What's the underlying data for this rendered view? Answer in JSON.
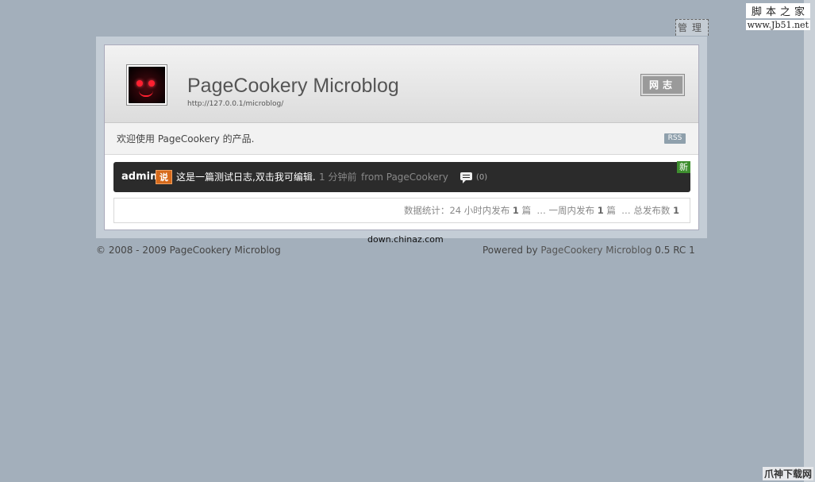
{
  "watermarks": {
    "top_line1": "脚本之家",
    "top_line2": "www.Jb51.net",
    "center": "down.chinaz.com",
    "bottom": "爪神下载网"
  },
  "admin_link": "管理",
  "header": {
    "title": "PageCookery Microblog",
    "url": "http://127.0.0.1/microblog/",
    "nav_button": "网志"
  },
  "welcome": {
    "text": "欢迎使用 PageCookery 的产品.",
    "rss_label": "RSS"
  },
  "post": {
    "author": "admin",
    "say_badge": "说",
    "content": "这是一篇测试日志,双击我可编辑.",
    "time": "1 分钟前",
    "from": "from PageCookery",
    "comment_count": "(0)",
    "new_badge": "新"
  },
  "stats": {
    "label": "数据统计：",
    "day_prefix": "24 小时内发布",
    "day_count": "1",
    "day_unit": "篇",
    "week_prefix": "… 一周内发布",
    "week_count": "1",
    "week_unit": "篇",
    "total_prefix": "… 总发布数",
    "total_count": "1"
  },
  "footer": {
    "copyright": "© 2008 - 2009 PageCookery Microblog",
    "powered_prefix": "Powered by",
    "powered_product": "PageCookery Microblog",
    "version": "0.5 RC 1"
  },
  "colors": {
    "background": "#a3afbb",
    "post_bg": "#2b2b2b",
    "say_badge": "#d66a1c",
    "new_badge": "#3e8e2f",
    "rss_badge": "#8fa0ac"
  },
  "icons": {
    "avatar": "dark-face-avatar",
    "comment": "speech-bubble-icon"
  }
}
